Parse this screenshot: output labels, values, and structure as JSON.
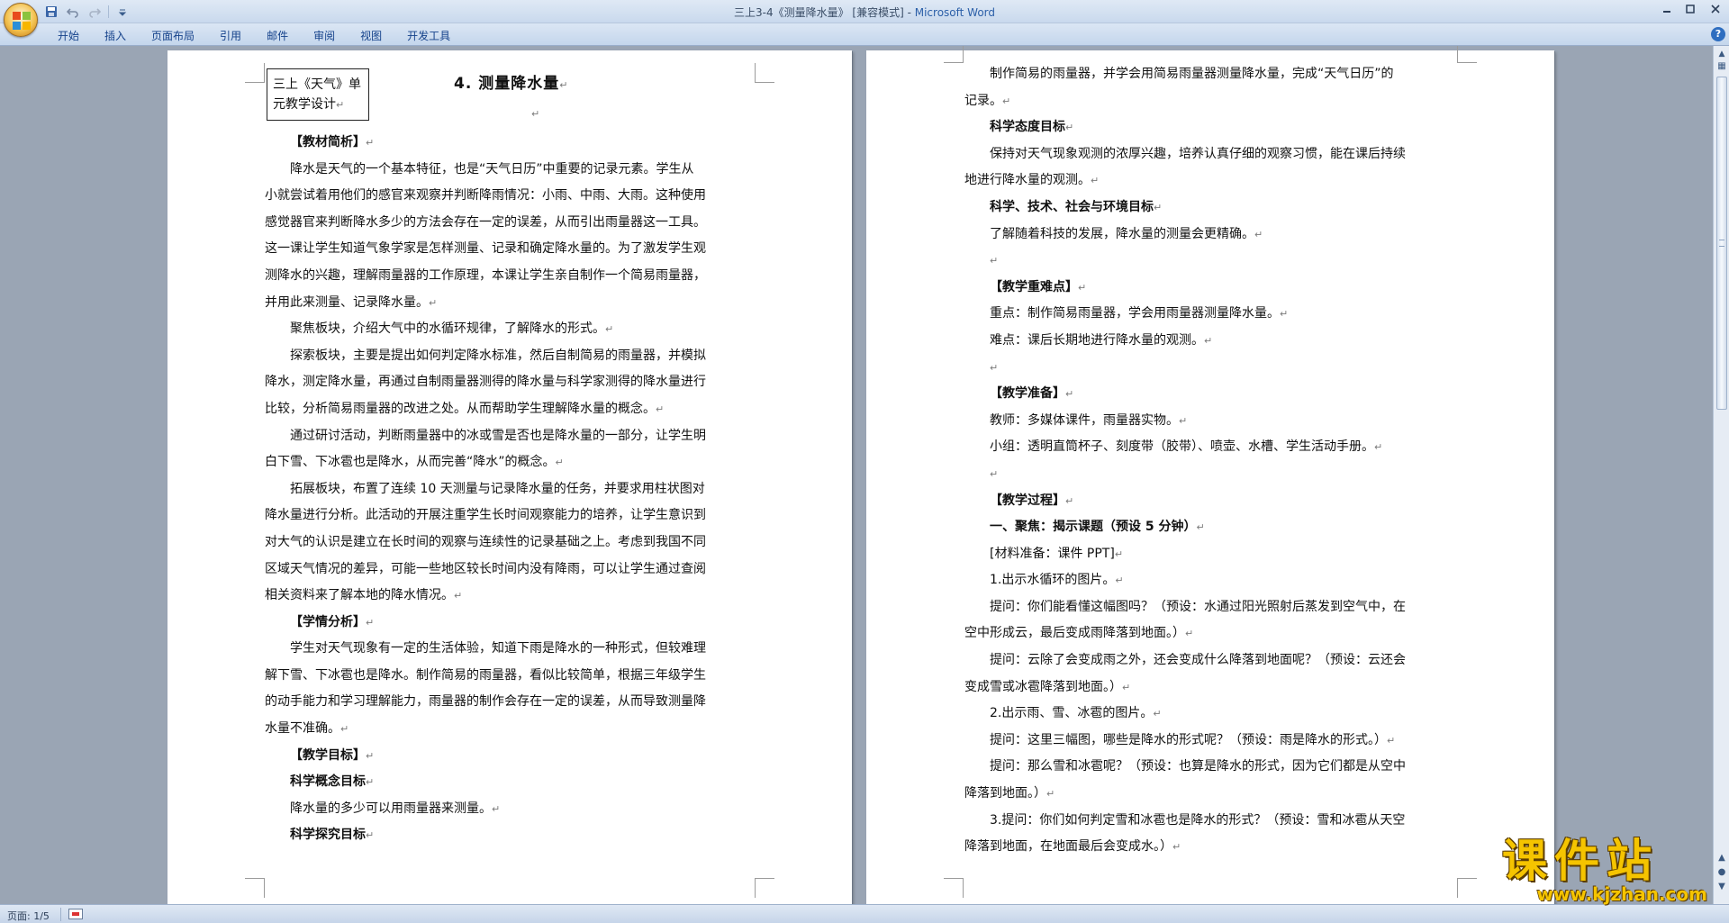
{
  "window": {
    "title_doc": "三上3-4《测量降水量》 [兼容模式] - ",
    "title_app": "Microsoft Word"
  },
  "ribbon": {
    "tabs": [
      "开始",
      "插入",
      "页面布局",
      "引用",
      "邮件",
      "审阅",
      "视图",
      "开发工具"
    ]
  },
  "left_page": {
    "unit_box": "三上《天气》单元教学设计",
    "title": "4. 测量降水量",
    "lines": [
      {
        "text": "【教材简析】",
        "indent": true,
        "bold": true
      },
      {
        "text": "降水是天气的一个基本特征，也是“天气日历”中重要的记录元素。学生从",
        "indent": true,
        "bold": false
      },
      {
        "text": "小就尝试着用他们的感官来观察并判断降雨情况：小雨、中雨、大雨。这种使用",
        "indent": false,
        "bold": false
      },
      {
        "text": "感觉器官来判断降水多少的方法会存在一定的误差，从而引出雨量器这一工具。",
        "indent": false,
        "bold": false
      },
      {
        "text": "这一课让学生知道气象学家是怎样测量、记录和确定降水量的。为了激发学生观",
        "indent": false,
        "bold": false
      },
      {
        "text": "测降水的兴趣，理解雨量器的工作原理，本课让学生亲自制作一个简易雨量器，",
        "indent": false,
        "bold": false
      },
      {
        "text": "并用此来测量、记录降水量。",
        "indent": false,
        "bold": false
      },
      {
        "text": "聚焦板块，介绍大气中的水循环规律，了解降水的形式。",
        "indent": true,
        "bold": false
      },
      {
        "text": "探索板块，主要是提出如何判定降水标准，然后自制简易的雨量器，并模拟",
        "indent": true,
        "bold": false
      },
      {
        "text": "降水，测定降水量，再通过自制雨量器测得的降水量与科学家测得的降水量进行",
        "indent": false,
        "bold": false
      },
      {
        "text": "比较，分析简易雨量器的改进之处。从而帮助学生理解降水量的概念。",
        "indent": false,
        "bold": false
      },
      {
        "text": "通过研讨活动，判断雨量器中的冰或雪是否也是降水量的一部分，让学生明",
        "indent": true,
        "bold": false
      },
      {
        "text": "白下雪、下冰雹也是降水，从而完善“降水”的概念。",
        "indent": false,
        "bold": false
      },
      {
        "text": "拓展板块，布置了连续 10 天测量与记录降水量的任务，并要求用柱状图对",
        "indent": true,
        "bold": false
      },
      {
        "text": "降水量进行分析。此活动的开展注重学生长时间观察能力的培养，让学生意识到",
        "indent": false,
        "bold": false
      },
      {
        "text": "对大气的认识是建立在长时间的观察与连续性的记录基础之上。考虑到我国不同",
        "indent": false,
        "bold": false
      },
      {
        "text": "区域天气情况的差异，可能一些地区较长时间内没有降雨，可以让学生通过查阅",
        "indent": false,
        "bold": false
      },
      {
        "text": "相关资料来了解本地的降水情况。",
        "indent": false,
        "bold": false
      },
      {
        "text": "【学情分析】",
        "indent": true,
        "bold": true
      },
      {
        "text": "学生对天气现象有一定的生活体验，知道下雨是降水的一种形式，但较难理",
        "indent": true,
        "bold": false
      },
      {
        "text": "解下雪、下冰雹也是降水。制作简易的雨量器，看似比较简单，根据三年级学生",
        "indent": false,
        "bold": false
      },
      {
        "text": "的动手能力和学习理解能力，雨量器的制作会存在一定的误差，从而导致测量降",
        "indent": false,
        "bold": false
      },
      {
        "text": "水量不准确。",
        "indent": false,
        "bold": false
      },
      {
        "text": "【教学目标】",
        "indent": true,
        "bold": true
      },
      {
        "text": "科学概念目标",
        "indent": true,
        "bold": true
      },
      {
        "text": "降水量的多少可以用雨量器来测量。",
        "indent": true,
        "bold": false
      },
      {
        "text": "科学探究目标",
        "indent": true,
        "bold": true
      }
    ]
  },
  "right_page": {
    "lines": [
      {
        "text": "制作简易的雨量器，并学会用简易雨量器测量降水量，完成“天气日历”的",
        "indent": true,
        "bold": false
      },
      {
        "text": "记录。",
        "indent": false,
        "bold": false
      },
      {
        "text": "科学态度目标",
        "indent": true,
        "bold": true
      },
      {
        "text": "保持对天气现象观测的浓厚兴趣，培养认真仔细的观察习惯，能在课后持续",
        "indent": true,
        "bold": false
      },
      {
        "text": "地进行降水量的观测。",
        "indent": false,
        "bold": false
      },
      {
        "text": "科学、技术、社会与环境目标",
        "indent": true,
        "bold": true
      },
      {
        "text": "了解随着科技的发展，降水量的测量会更精确。",
        "indent": true,
        "bold": false
      },
      {
        "text": "",
        "indent": true,
        "bold": false
      },
      {
        "text": "【教学重难点】",
        "indent": true,
        "bold": true
      },
      {
        "text": "重点：制作简易雨量器，学会用雨量器测量降水量。",
        "indent": true,
        "bold": false
      },
      {
        "text": "难点：课后长期地进行降水量的观测。",
        "indent": true,
        "bold": false
      },
      {
        "text": "",
        "indent": true,
        "bold": false
      },
      {
        "text": "【教学准备】",
        "indent": true,
        "bold": true
      },
      {
        "text": "教师：多媒体课件，雨量器实物。",
        "indent": true,
        "bold": false
      },
      {
        "text": "小组：透明直筒杯子、刻度带（胶带）、喷壶、水槽、学生活动手册。",
        "indent": true,
        "bold": false
      },
      {
        "text": "",
        "indent": true,
        "bold": false
      },
      {
        "text": "【教学过程】",
        "indent": true,
        "bold": true
      },
      {
        "text": "一、聚焦：揭示课题（预设 5 分钟）",
        "indent": true,
        "bold": true
      },
      {
        "text": "[材料准备：课件 PPT]",
        "indent": true,
        "bold": false
      },
      {
        "text": "1.出示水循环的图片。",
        "indent": true,
        "bold": false
      },
      {
        "text": "提问：你们能看懂这幅图吗？（预设：水通过阳光照射后蒸发到空气中，在",
        "indent": true,
        "bold": false
      },
      {
        "text": "空中形成云，最后变成雨降落到地面。）",
        "indent": false,
        "bold": false
      },
      {
        "text": "提问：云除了会变成雨之外，还会变成什么降落到地面呢？（预设：云还会",
        "indent": true,
        "bold": false
      },
      {
        "text": "变成雪或冰雹降落到地面。）",
        "indent": false,
        "bold": false
      },
      {
        "text": "2.出示雨、雪、冰雹的图片。",
        "indent": true,
        "bold": false
      },
      {
        "text": "提问：这里三幅图，哪些是降水的形式呢？（预设：雨是降水的形式。）",
        "indent": true,
        "bold": false
      },
      {
        "text": "提问：那么雪和冰雹呢？（预设：也算是降水的形式，因为它们都是从空中",
        "indent": true,
        "bold": false
      },
      {
        "text": "降落到地面。）",
        "indent": false,
        "bold": false
      },
      {
        "text": "3.提问：你们如何判定雪和冰雹也是降水的形式？（预设：雪和冰雹从天空",
        "indent": true,
        "bold": false
      },
      {
        "text": "降落到地面，在地面最后会变成水。）",
        "indent": false,
        "bold": false
      }
    ]
  },
  "status": {
    "page_count": "页面: 1/5"
  },
  "watermark": {
    "text": "课件站",
    "url": "www.kjzhan.com"
  },
  "icons": {
    "office_button": "office-logo-icon",
    "save": "save-icon",
    "undo": "undo-icon",
    "redo": "redo-icon",
    "customize": "customize-qat-icon",
    "paragraph_mark": "paragraph-mark-icon"
  },
  "colors": {
    "title_app": "#2b5fa8",
    "ribbon_tab_text": "#15428b",
    "watermark": "#f5c400",
    "workspace": "#9aa5b4"
  }
}
